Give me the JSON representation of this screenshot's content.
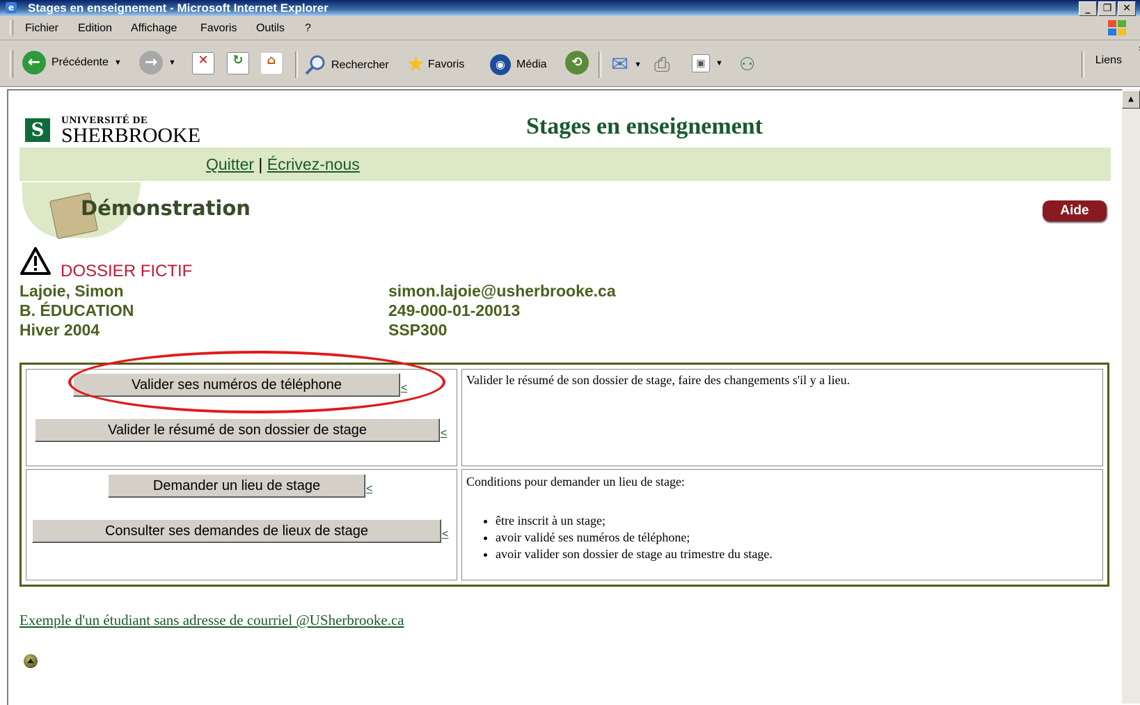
{
  "window": {
    "title": "Stages en enseignement - Microsoft Internet Explorer",
    "min_glyph": "_",
    "max_glyph": "❐",
    "close_glyph": "✕"
  },
  "menu": [
    "Fichier",
    "Edition",
    "Affichage",
    "Favoris",
    "Outils",
    "?"
  ],
  "toolbar": {
    "back_label": "Précédente",
    "search_label": "Rechercher",
    "favorites_label": "Favoris",
    "media_label": "Média",
    "links_label": "Liens",
    "chevron": "»"
  },
  "header": {
    "logo_top": "UNIVERSITÉ DE",
    "logo_main": "SHERBROOKE",
    "logo_mark": "S",
    "title": "Stages en enseignement"
  },
  "nav": {
    "quit": "Quitter",
    "separator": "|",
    "write": "Écrivez-nous"
  },
  "section": {
    "title": "Démonstration",
    "help_button": "Aide"
  },
  "warning": {
    "label": "DOSSIER FICTIF"
  },
  "student": {
    "name": "Lajoie, Simon",
    "program": "B. ÉDUCATION",
    "session": "Hiver 2004",
    "email": "simon.lajoie@usherbrooke.ca",
    "id": "249-000-01-20013",
    "course": "SSP300"
  },
  "actions": {
    "validate_phone": "Valider ses numéros de téléphone",
    "validate_summary": "Valider le résumé de son dossier de stage",
    "request_site": "Demander un lieu de stage",
    "view_requests": "Consulter ses demandes de lieux de stage",
    "arrow": "<"
  },
  "descriptions": {
    "summary": "Valider le résumé de son dossier de stage, faire des changements s'il y a lieu.",
    "conditions_title": "Conditions pour demander un lieu de stage:",
    "conditions": [
      "être inscrit à un stage;",
      "avoir validé ses numéros de téléphone;",
      "avoir valider son dossier de stage au trimestre du stage."
    ]
  },
  "footer": {
    "example_link": "Exemple d'un étudiant sans adresse de courriel @USherbrooke.ca"
  },
  "colors": {
    "accent_green": "#1a5a2e",
    "band": "#dde8c6",
    "warning_red": "#c0183a",
    "help_button": "#8a1a22",
    "annotation": "#e01a1a"
  }
}
